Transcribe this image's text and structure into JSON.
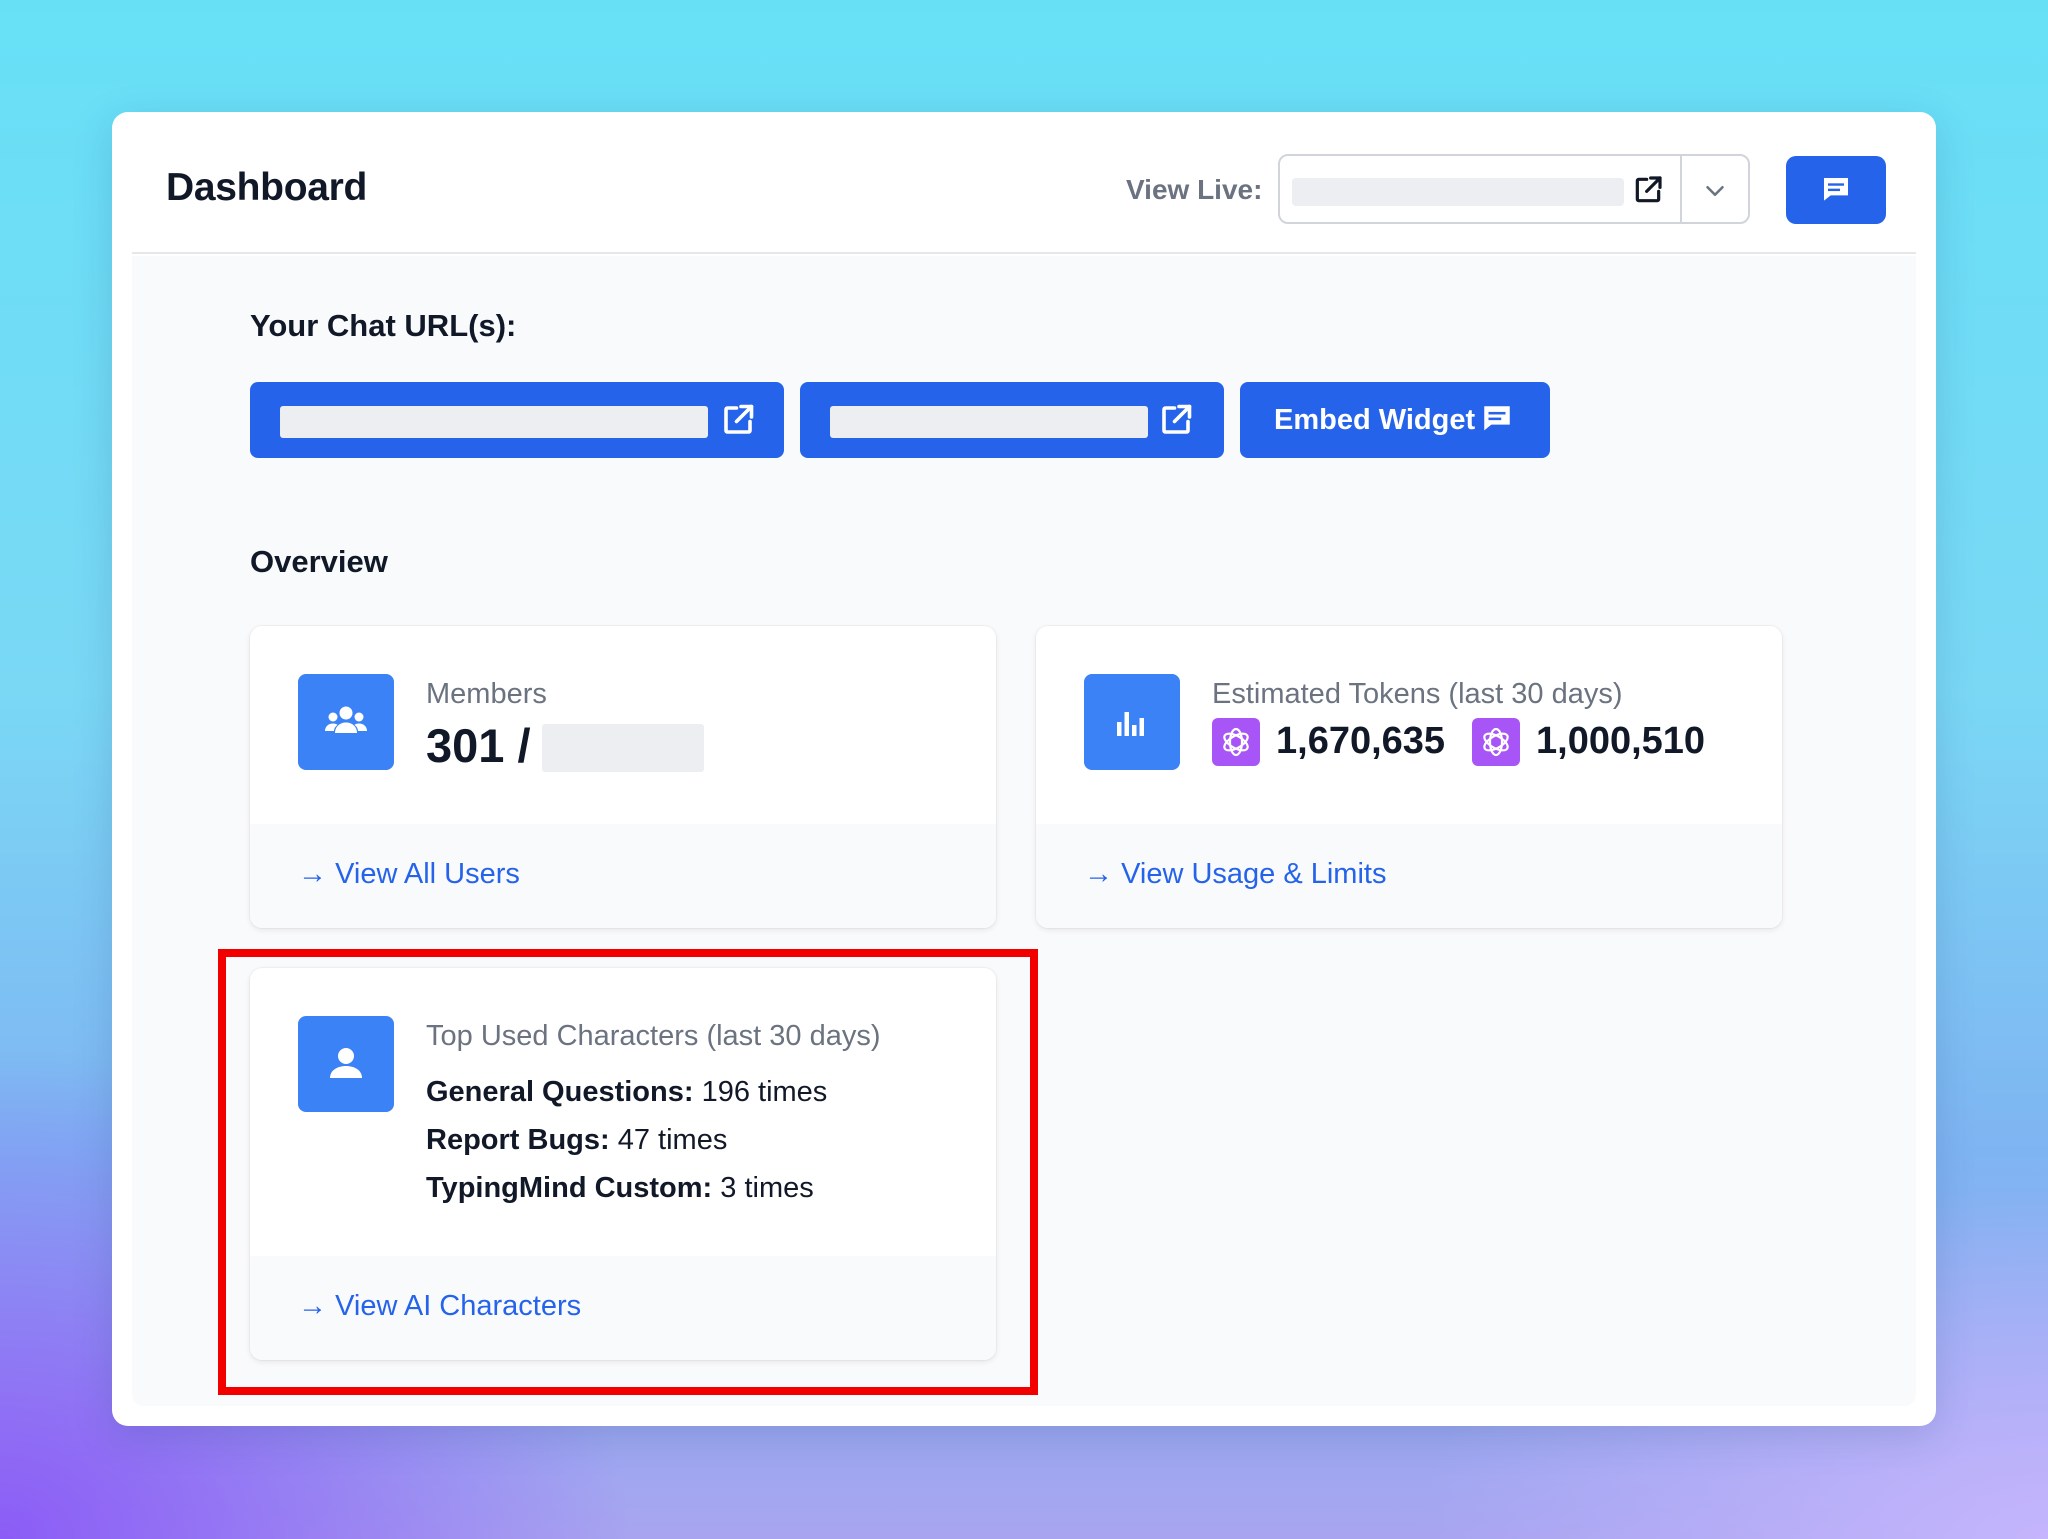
{
  "header": {
    "title": "Dashboard",
    "view_live_label": "View Live:"
  },
  "chat_urls": {
    "title": "Your Chat URL(s):",
    "embed_label": "Embed Widget"
  },
  "overview": {
    "title": "Overview",
    "members": {
      "label": "Members",
      "value": "301 /",
      "link": "View All Users"
    },
    "tokens": {
      "label": "Estimated Tokens (last 30 days)",
      "value_1": "1,670,635",
      "value_2": "1,000,510",
      "link": "View Usage & Limits"
    },
    "characters": {
      "label": "Top Used Characters (last 30 days)",
      "items": [
        {
          "name": "General Questions:",
          "count": "196 times"
        },
        {
          "name": "Report Bugs:",
          "count": "47 times"
        },
        {
          "name": "TypingMind Custom:",
          "count": "3 times"
        }
      ],
      "link": "View AI Characters"
    }
  },
  "colors": {
    "primary": "#2563eb",
    "icon_bg": "#3b82f6",
    "openai_bg": "#a855f7",
    "highlight": "#f20000"
  },
  "icons": {
    "members": "users-icon",
    "tokens": "bar-chart-icon",
    "characters": "user-icon",
    "external": "external-link-icon",
    "chat": "chat-bubble-icon",
    "dropdown": "chevron-down-icon",
    "model": "openai-icon"
  }
}
